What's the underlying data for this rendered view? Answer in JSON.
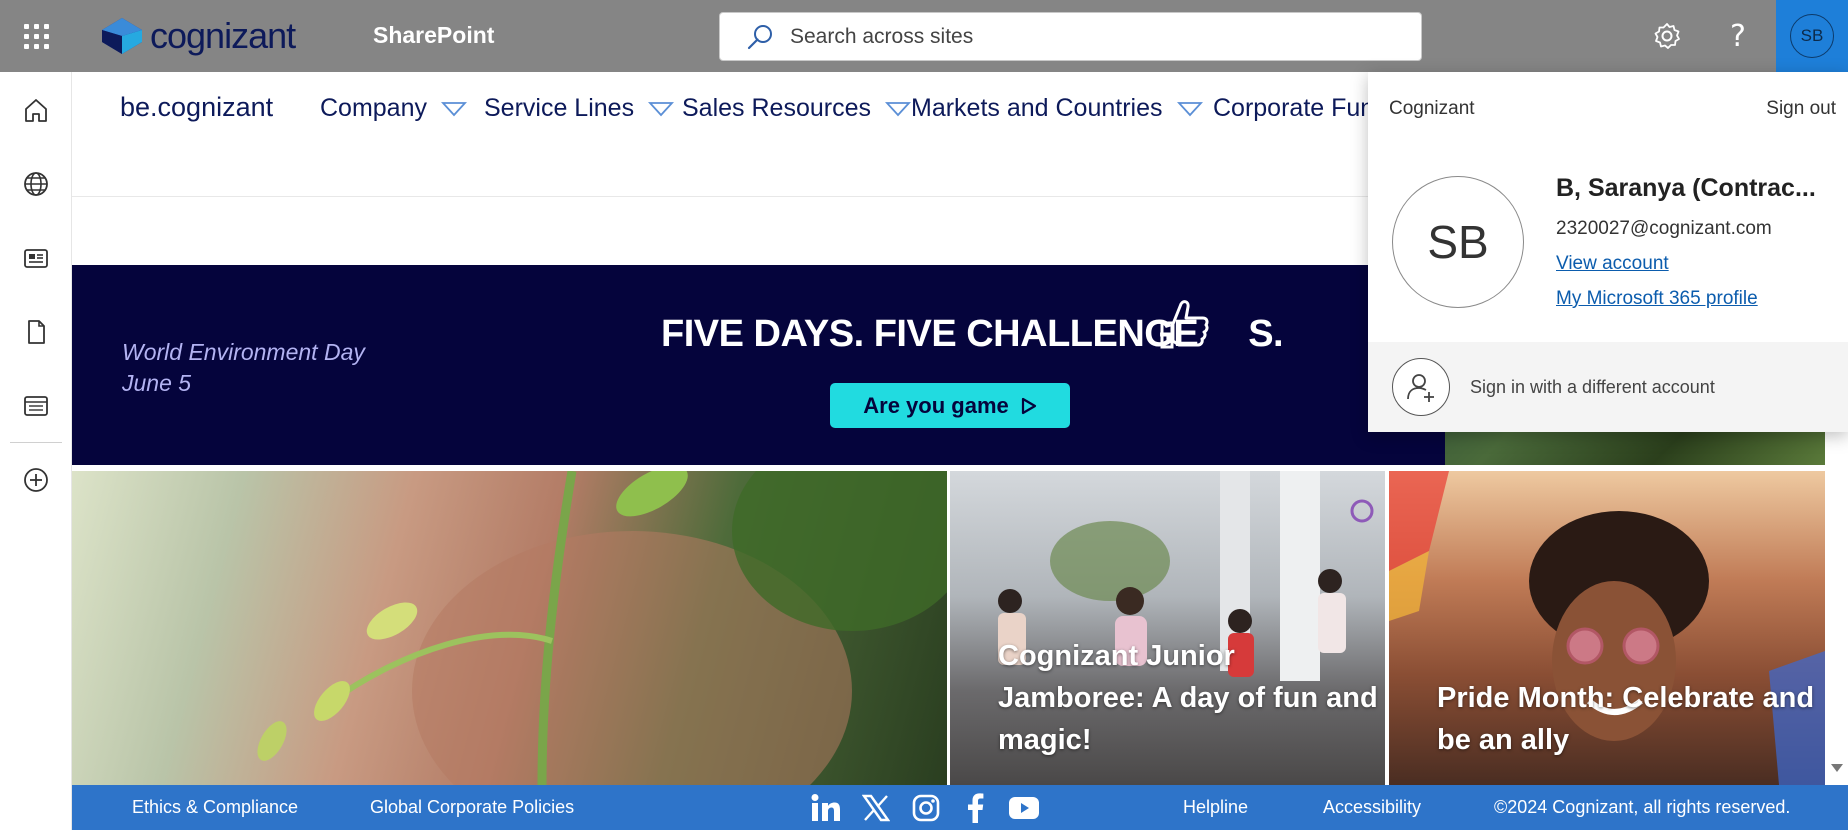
{
  "suitebar": {
    "logo_text": "cognizant",
    "app_name": "SharePoint",
    "search_placeholder": "Search across sites",
    "settings_icon": "gear-icon",
    "help_label": "?",
    "avatar_initials": "SB",
    "colors": {
      "bar": "#858585",
      "me": "#1e7fd9"
    }
  },
  "leftrail": {
    "items": [
      {
        "icon": "home-icon"
      },
      {
        "icon": "globe-icon"
      },
      {
        "icon": "news-icon"
      },
      {
        "icon": "document-icon"
      },
      {
        "icon": "list-icon"
      },
      {
        "icon": "add-circle-icon"
      }
    ]
  },
  "hubnav": {
    "site_title": "be.cognizant",
    "items": [
      {
        "label": "Company"
      },
      {
        "label": "Service Lines"
      },
      {
        "label": "Sales Resources"
      },
      {
        "label": "Markets and Countries"
      },
      {
        "label": "Corporate Func"
      }
    ]
  },
  "banner": {
    "event_name": "World Environment Day",
    "event_date": "June 5",
    "headline": "FIVE DAYS. FIVE CHALLENGE",
    "headline_suffix": "S.",
    "cta_label": "Are you game",
    "colors": {
      "background": "#05043c",
      "cta": "#21dbe0"
    }
  },
  "tiles": [
    {
      "title": ""
    },
    {
      "title": "Cognizant Junior Jamboree: A day of fun and magic!"
    },
    {
      "title": "Pride Month: Celebrate and be an ally"
    }
  ],
  "footer": {
    "links": [
      "Ethics & Compliance",
      "Global Corporate Policies"
    ],
    "social": [
      "linkedin-icon",
      "x-icon",
      "instagram-icon",
      "facebook-icon",
      "youtube-icon"
    ],
    "right_links": [
      "Helpline",
      "Accessibility"
    ],
    "copyright": "©2024 Cognizant, all rights reserved.",
    "colors": {
      "background": "#2e74c9"
    }
  },
  "account_flyout": {
    "org": "Cognizant",
    "sign_out": "Sign out",
    "initials": "SB",
    "name": "B, Saranya (Contrac...",
    "email": "2320027@cognizant.com",
    "view_account": "View account",
    "profile_link": "My Microsoft 365 profile",
    "other_account": "Sign in with a different account"
  }
}
